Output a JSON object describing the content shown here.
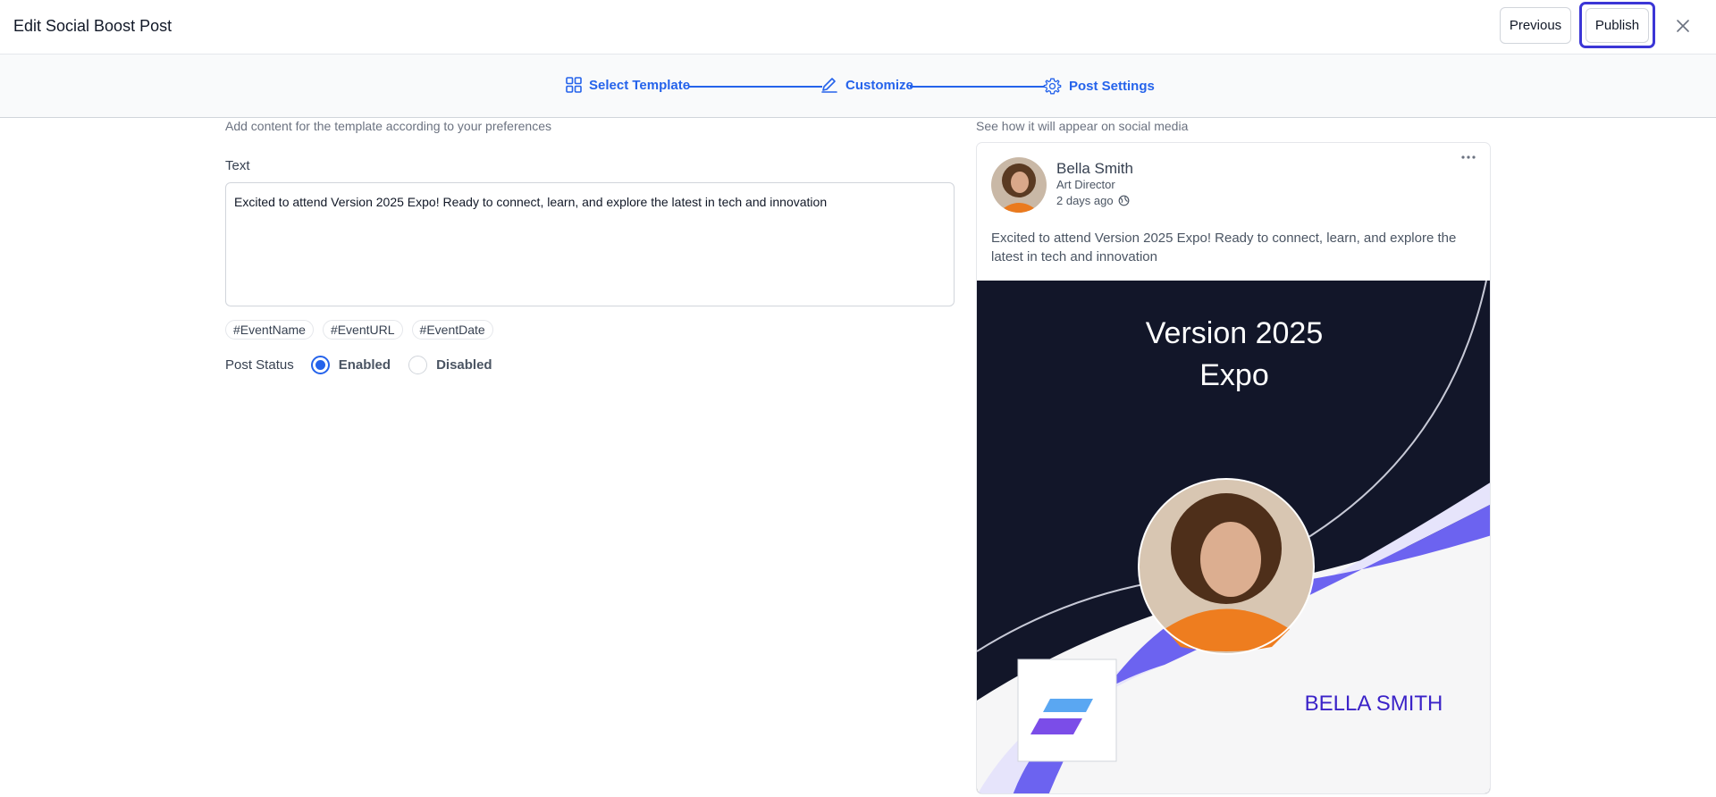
{
  "header": {
    "title": "Edit Social Boost Post",
    "previous_label": "Previous",
    "publish_label": "Publish"
  },
  "stepper": {
    "steps": [
      {
        "label": "Select Template",
        "icon": "grid-icon"
      },
      {
        "label": "Customize",
        "icon": "pencil-icon"
      },
      {
        "label": "Post Settings",
        "icon": "gear-icon"
      }
    ],
    "color": "#2563eb"
  },
  "form": {
    "description": "Add content for the template according to your preferences",
    "text_label": "Text",
    "text_value": "Excited to attend Version 2025 Expo! Ready to connect, learn, and explore the latest in tech and innovation",
    "chips": [
      "#EventName",
      "#EventURL",
      "#EventDate"
    ],
    "status_label": "Post Status",
    "status_options": [
      "Enabled",
      "Disabled"
    ],
    "status_selected": "Enabled"
  },
  "preview": {
    "description": "See how it will appear on social media",
    "author_name": "Bella Smith",
    "author_role": "Art Director",
    "posted_time": "2 days ago",
    "post_text": "Excited to attend Version 2025 Expo! Ready to connect, learn, and explore the latest in tech and innovation",
    "banner": {
      "title_line1": "Version 2025",
      "title_line2": "Expo",
      "name": "BELLA SMITH",
      "colors": {
        "dark": "#121629",
        "accent": "#6c63f0",
        "name": "#3b23c8"
      }
    }
  }
}
